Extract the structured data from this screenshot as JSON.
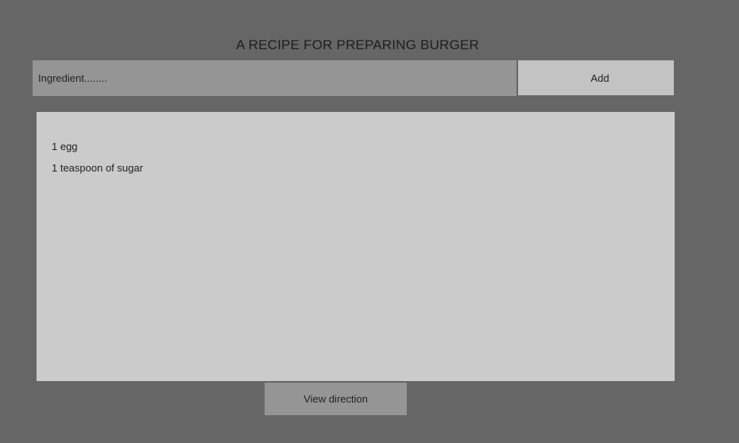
{
  "page": {
    "title": "A RECIPE FOR PREPARING BURGER"
  },
  "form": {
    "ingredient_placeholder": "Ingredient........",
    "ingredient_value": "",
    "add_label": "Add"
  },
  "ingredients": {
    "items": [
      {
        "label": "1 egg"
      },
      {
        "label": "1 teaspoon of sugar"
      }
    ]
  },
  "footer": {
    "view_direction_label": "View direction"
  },
  "colors": {
    "page_background": "#666666",
    "input_background": "#959595",
    "add_button_background": "#c3c3c3",
    "list_background": "#cbcbcb",
    "view_direction_background": "#959595",
    "text": "#222222"
  }
}
